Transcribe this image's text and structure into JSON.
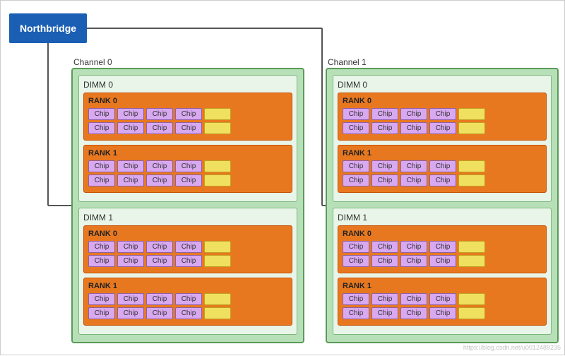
{
  "northbridge": {
    "label": "Northbridge"
  },
  "channels": [
    {
      "label": "Channel 0",
      "dimms": [
        {
          "label": "DIMM 0",
          "ranks": [
            {
              "label": "RANK 0",
              "rows": [
                [
                  "Chip",
                  "Chip",
                  "Chip",
                  "Chip"
                ],
                [
                  "Chip",
                  "Chip",
                  "Chip",
                  "Chip"
                ]
              ]
            },
            {
              "label": "RANK 1",
              "rows": [
                [
                  "Chip",
                  "Chip",
                  "Chip",
                  "Chip"
                ],
                [
                  "Chip",
                  "Chip",
                  "Chip",
                  "Chip"
                ]
              ]
            }
          ]
        },
        {
          "label": "DIMM 1",
          "ranks": [
            {
              "label": "RANK 0",
              "rows": [
                [
                  "Chip",
                  "Chip",
                  "Chip",
                  "Chip"
                ],
                [
                  "Chip",
                  "Chip",
                  "Chip",
                  "Chip"
                ]
              ]
            },
            {
              "label": "RANK 1",
              "rows": [
                [
                  "Chip",
                  "Chip",
                  "Chip",
                  "Chip"
                ],
                [
                  "Chip",
                  "Chip",
                  "Chip",
                  "Chip"
                ]
              ]
            }
          ]
        }
      ]
    },
    {
      "label": "Channel 1",
      "dimms": [
        {
          "label": "DIMM 0",
          "ranks": [
            {
              "label": "RANK 0",
              "rows": [
                [
                  "Chip",
                  "Chip",
                  "Chip",
                  "Chip"
                ],
                [
                  "Chip",
                  "Chip",
                  "Chip",
                  "Chip"
                ]
              ]
            },
            {
              "label": "RANK 1",
              "rows": [
                [
                  "Chip",
                  "Chip",
                  "Chip",
                  "Chip"
                ],
                [
                  "Chip",
                  "Chip",
                  "Chip",
                  "Chip"
                ]
              ]
            }
          ]
        },
        {
          "label": "DIMM 1",
          "ranks": [
            {
              "label": "RANK 0",
              "rows": [
                [
                  "Chip",
                  "Chip",
                  "Chip",
                  "Chip"
                ],
                [
                  "Chip",
                  "Chip",
                  "Chip",
                  "Chip"
                ]
              ]
            },
            {
              "label": "RANK 1",
              "rows": [
                [
                  "Chip",
                  "Chip",
                  "Chip",
                  "Chip"
                ],
                [
                  "Chip",
                  "Chip",
                  "Chip",
                  "Chip"
                ]
              ]
            }
          ]
        }
      ]
    }
  ],
  "watermark": "https://blog.csdn.net/u0012489235"
}
